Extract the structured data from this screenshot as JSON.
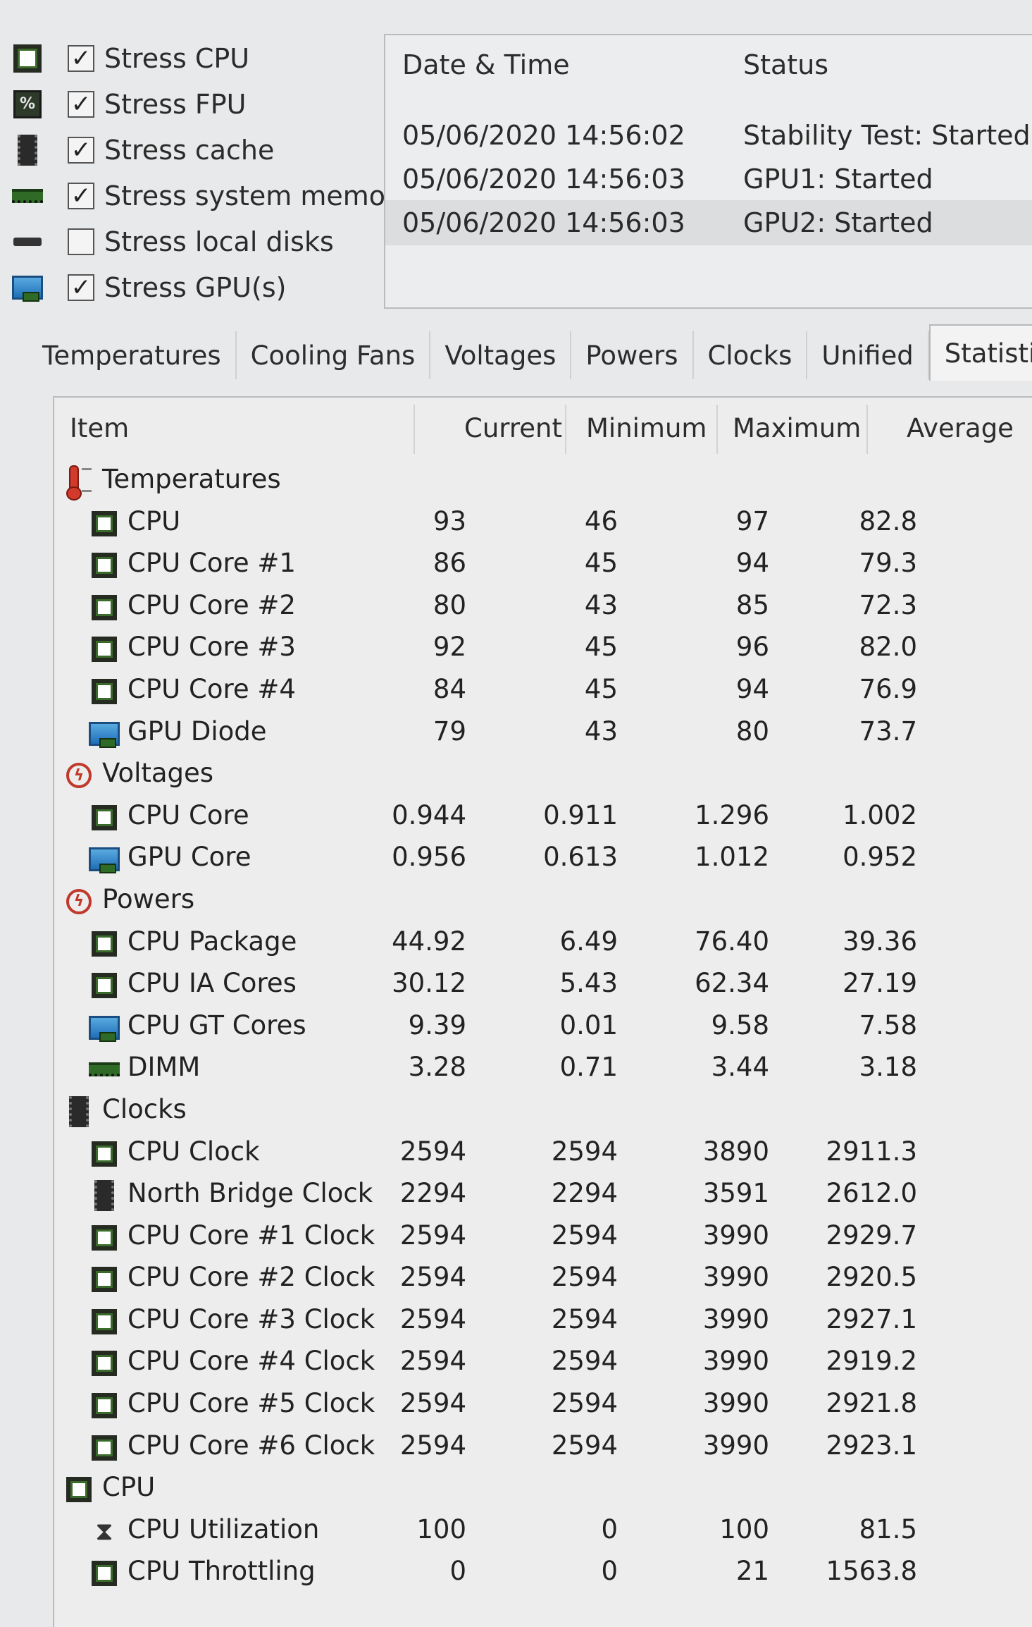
{
  "stress_options": [
    {
      "label": "Stress CPU",
      "checked": true,
      "icon": "cpu-chip-icon"
    },
    {
      "label": "Stress FPU",
      "checked": true,
      "icon": "fpu-chip-icon"
    },
    {
      "label": "Stress cache",
      "checked": true,
      "icon": "cache-icon"
    },
    {
      "label": "Stress system memory",
      "checked": true,
      "icon": "memory-icon"
    },
    {
      "label": "Stress local disks",
      "checked": false,
      "icon": "disk-icon"
    },
    {
      "label": "Stress GPU(s)",
      "checked": true,
      "icon": "gpu-icon"
    }
  ],
  "log": {
    "headers": {
      "datetime": "Date & Time",
      "status": "Status"
    },
    "rows": [
      {
        "datetime": "05/06/2020 14:56:02",
        "status": "Stability Test: Started"
      },
      {
        "datetime": "05/06/2020 14:56:03",
        "status": "GPU1: Started"
      },
      {
        "datetime": "05/06/2020 14:56:03",
        "status": "GPU2: Started"
      }
    ]
  },
  "tabs": [
    {
      "label": "Temperatures",
      "active": false
    },
    {
      "label": "Cooling Fans",
      "active": false
    },
    {
      "label": "Voltages",
      "active": false
    },
    {
      "label": "Powers",
      "active": false
    },
    {
      "label": "Clocks",
      "active": false
    },
    {
      "label": "Unified",
      "active": false
    },
    {
      "label": "Statistics",
      "active": true
    }
  ],
  "stats": {
    "headers": {
      "item": "Item",
      "current": "Current",
      "minimum": "Minimum",
      "maximum": "Maximum",
      "average": "Average"
    },
    "rows": [
      {
        "type": "group",
        "label": "Temperatures",
        "icon": "thermometer-icon"
      },
      {
        "type": "item",
        "label": "CPU",
        "icon": "cpu-chip-icon",
        "current": "93",
        "minimum": "46",
        "maximum": "97",
        "average": "82.8"
      },
      {
        "type": "item",
        "label": "CPU Core #1",
        "icon": "cpu-chip-icon",
        "current": "86",
        "minimum": "45",
        "maximum": "94",
        "average": "79.3"
      },
      {
        "type": "item",
        "label": "CPU Core #2",
        "icon": "cpu-chip-icon",
        "current": "80",
        "minimum": "43",
        "maximum": "85",
        "average": "72.3"
      },
      {
        "type": "item",
        "label": "CPU Core #3",
        "icon": "cpu-chip-icon",
        "current": "92",
        "minimum": "45",
        "maximum": "96",
        "average": "82.0"
      },
      {
        "type": "item",
        "label": "CPU Core #4",
        "icon": "cpu-chip-icon",
        "current": "84",
        "minimum": "45",
        "maximum": "94",
        "average": "76.9"
      },
      {
        "type": "item",
        "label": "GPU Diode",
        "icon": "gpu-icon",
        "current": "79",
        "minimum": "43",
        "maximum": "80",
        "average": "73.7"
      },
      {
        "type": "group",
        "label": "Voltages",
        "icon": "bolt-icon"
      },
      {
        "type": "item",
        "label": "CPU Core",
        "icon": "cpu-chip-icon",
        "current": "0.944",
        "minimum": "0.911",
        "maximum": "1.296",
        "average": "1.002"
      },
      {
        "type": "item",
        "label": "GPU Core",
        "icon": "gpu-icon",
        "current": "0.956",
        "minimum": "0.613",
        "maximum": "1.012",
        "average": "0.952"
      },
      {
        "type": "group",
        "label": "Powers",
        "icon": "bolt-icon"
      },
      {
        "type": "item",
        "label": "CPU Package",
        "icon": "cpu-chip-icon",
        "current": "44.92",
        "minimum": "6.49",
        "maximum": "76.40",
        "average": "39.36"
      },
      {
        "type": "item",
        "label": "CPU IA Cores",
        "icon": "cpu-chip-icon",
        "current": "30.12",
        "minimum": "5.43",
        "maximum": "62.34",
        "average": "27.19"
      },
      {
        "type": "item",
        "label": "CPU GT Cores",
        "icon": "gpu-icon",
        "current": "9.39",
        "minimum": "0.01",
        "maximum": "9.58",
        "average": "7.58"
      },
      {
        "type": "item",
        "label": "DIMM",
        "icon": "memory-icon",
        "current": "3.28",
        "minimum": "0.71",
        "maximum": "3.44",
        "average": "3.18"
      },
      {
        "type": "group",
        "label": "Clocks",
        "icon": "cache-icon"
      },
      {
        "type": "item",
        "label": "CPU Clock",
        "icon": "cpu-chip-icon",
        "current": "2594",
        "minimum": "2594",
        "maximum": "3890",
        "average": "2911.3"
      },
      {
        "type": "item",
        "label": "North Bridge Clock",
        "icon": "cache-icon",
        "current": "2294",
        "minimum": "2294",
        "maximum": "3591",
        "average": "2612.0"
      },
      {
        "type": "item",
        "label": "CPU Core #1 Clock",
        "icon": "cpu-chip-icon",
        "current": "2594",
        "minimum": "2594",
        "maximum": "3990",
        "average": "2929.7"
      },
      {
        "type": "item",
        "label": "CPU Core #2 Clock",
        "icon": "cpu-chip-icon",
        "current": "2594",
        "minimum": "2594",
        "maximum": "3990",
        "average": "2920.5"
      },
      {
        "type": "item",
        "label": "CPU Core #3 Clock",
        "icon": "cpu-chip-icon",
        "current": "2594",
        "minimum": "2594",
        "maximum": "3990",
        "average": "2927.1"
      },
      {
        "type": "item",
        "label": "CPU Core #4 Clock",
        "icon": "cpu-chip-icon",
        "current": "2594",
        "minimum": "2594",
        "maximum": "3990",
        "average": "2919.2"
      },
      {
        "type": "item",
        "label": "CPU Core #5 Clock",
        "icon": "cpu-chip-icon",
        "current": "2594",
        "minimum": "2594",
        "maximum": "3990",
        "average": "2921.8"
      },
      {
        "type": "item",
        "label": "CPU Core #6 Clock",
        "icon": "cpu-chip-icon",
        "current": "2594",
        "minimum": "2594",
        "maximum": "3990",
        "average": "2923.1"
      },
      {
        "type": "group",
        "label": "CPU",
        "icon": "cpu-chip-icon"
      },
      {
        "type": "item",
        "label": "CPU Utilization",
        "icon": "hourglass-icon",
        "current": "100",
        "minimum": "0",
        "maximum": "100",
        "average": "81.5"
      },
      {
        "type": "item",
        "label": "CPU Throttling",
        "icon": "cpu-chip-icon",
        "current": "0",
        "minimum": "0",
        "maximum": "21",
        "average": "1563.8"
      }
    ]
  }
}
